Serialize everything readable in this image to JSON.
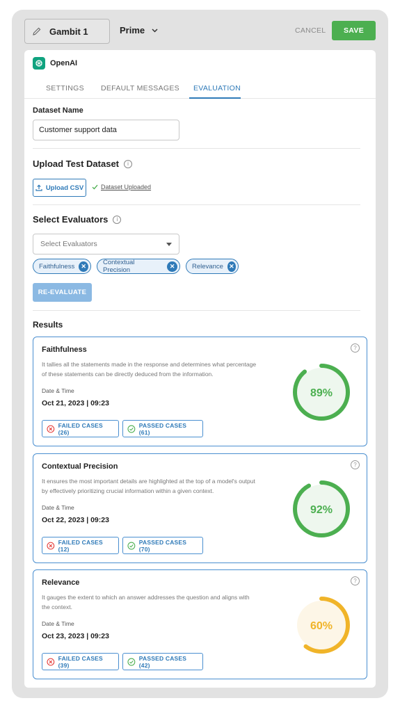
{
  "topbar": {
    "name": "Gambit 1",
    "model": "Prime",
    "cancel_label": "CANCEL",
    "save_label": "SAVE"
  },
  "provider": {
    "name": "OpenAI"
  },
  "tabs": [
    {
      "label": "SETTINGS"
    },
    {
      "label": "DEFAULT MESSAGES"
    },
    {
      "label": "EVALUATION",
      "active": true
    }
  ],
  "dataset": {
    "label": "Dataset Name",
    "value": "Customer support data"
  },
  "upload": {
    "title": "Upload Test Dataset",
    "button_label": "Upload CSV",
    "status": "Dataset Uploaded"
  },
  "evaluators": {
    "title": "Select Evaluators",
    "placeholder": "Select Evaluators",
    "chips": [
      "Faithfulness",
      "Contextual Precision",
      "Relevance"
    ],
    "reevaluate_label": "RE-EVALUATE"
  },
  "results": {
    "title": "Results",
    "date_label": "Date & Time",
    "cards": [
      {
        "title": "Faithfulness",
        "desc_line1": "It tallies all the statements made in the response and determines what percentage",
        "desc_line2": "of these statements can be directly deduced from the information.",
        "date": "Oct 21, 2023 | 09:23",
        "failed": "FAILED CASES (26)",
        "passed": "PASSED CASES (61)",
        "score": 89,
        "score_label": "89%",
        "color": "#4caf50",
        "bg": "#eef7ee"
      },
      {
        "title": "Contextual Precision",
        "desc_line1": "It ensures the most important details are highlighted at the top of a model's output",
        "desc_line2": "by effectively prioritizing crucial information within a given context.",
        "date": "Oct 22, 2023 | 09:23",
        "failed": "FAILED CASES (12)",
        "passed": "PASSED CASES (70)",
        "score": 92,
        "score_label": "92%",
        "color": "#4caf50",
        "bg": "#eef7ee"
      },
      {
        "title": "Relevance",
        "desc_line1": "It gauges the extent to which an answer addresses the question and aligns with",
        "desc_line2": "the context.",
        "date": "Oct 23, 2023 | 09:23",
        "failed": "FAILED CASES (39)",
        "passed": "PASSED CASES (42)",
        "score": 60,
        "score_label": "60%",
        "color": "#f0b429",
        "bg": "#fdf6e7"
      }
    ]
  }
}
